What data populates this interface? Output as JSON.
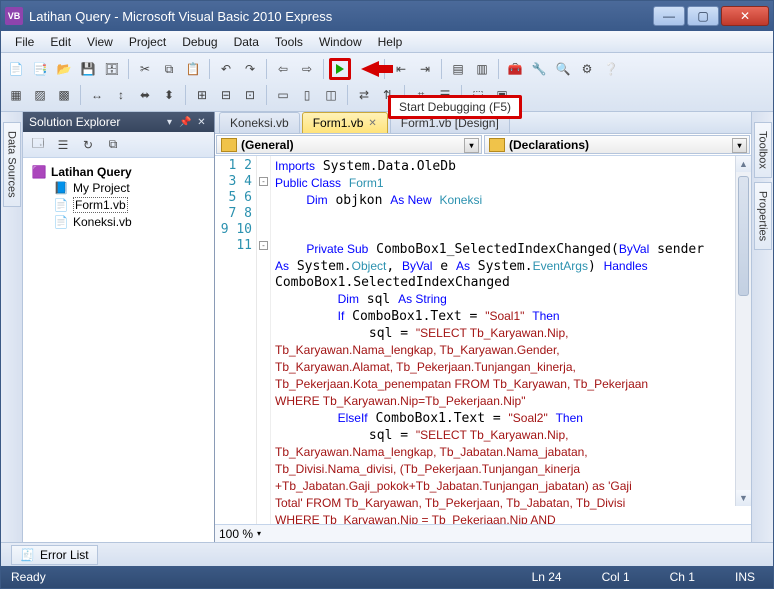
{
  "window": {
    "title": "Latihan Query - Microsoft Visual Basic 2010 Express",
    "icon_text": "VB"
  },
  "menu": [
    "File",
    "Edit",
    "View",
    "Project",
    "Debug",
    "Data",
    "Tools",
    "Window",
    "Help"
  ],
  "tooltip": "Start Debugging (F5)",
  "left_tabs": [
    "Data Sources"
  ],
  "right_tabs": [
    "Toolbox",
    "Properties"
  ],
  "solution": {
    "title": "Solution Explorer",
    "project": "Latihan Query",
    "items": [
      "My Project",
      "Form1.vb",
      "Koneksi.vb"
    ],
    "selected": "Form1.vb"
  },
  "tabs": [
    {
      "label": "Koneksi.vb",
      "active": false
    },
    {
      "label": "Form1.vb",
      "active": true,
      "close": true
    },
    {
      "label": "Form1.vb [Design]",
      "active": false
    }
  ],
  "combos": {
    "left": "(General)",
    "right": "(Declarations)"
  },
  "zoom": "100 %",
  "status": {
    "ready": "Ready",
    "ln": "Ln 24",
    "col": "Col 1",
    "ch": "Ch 1",
    "ins": "INS"
  },
  "error_list": "Error List",
  "gutter": [
    "1",
    "2",
    "3",
    "4",
    "5",
    "6",
    "",
    "",
    "7",
    "8",
    "9",
    "",
    "",
    "",
    "",
    "10",
    "11",
    "",
    "",
    "",
    "",
    "",
    ""
  ],
  "code_lines": [
    [
      {
        "k": "Imports"
      },
      {
        "p": " System.Data.OleDb"
      }
    ],
    [
      {
        "k": "Public Class"
      },
      {
        "p": " "
      },
      {
        "t": "Form1"
      }
    ],
    [
      {
        "p": "    "
      },
      {
        "k": "Dim"
      },
      {
        "p": " objkon "
      },
      {
        "k": "As New"
      },
      {
        "p": " "
      },
      {
        "t": "Koneksi"
      }
    ],
    [
      {
        "p": " "
      }
    ],
    [
      {
        "p": " "
      }
    ],
    [
      {
        "p": "    "
      },
      {
        "k": "Private Sub"
      },
      {
        "p": " ComboBox1_SelectedIndexChanged("
      },
      {
        "k": "ByVal"
      },
      {
        "p": " sender"
      }
    ],
    [
      {
        "k": "As"
      },
      {
        "p": " System."
      },
      {
        "t": "Object"
      },
      {
        "p": ", "
      },
      {
        "k": "ByVal"
      },
      {
        "p": " e "
      },
      {
        "k": "As"
      },
      {
        "p": " System."
      },
      {
        "t": "EventArgs"
      },
      {
        "p": ") "
      },
      {
        "k": "Handles"
      }
    ],
    [
      {
        "p": "ComboBox1.SelectedIndexChanged"
      }
    ],
    [
      {
        "p": "        "
      },
      {
        "k": "Dim"
      },
      {
        "p": " sql "
      },
      {
        "k": "As String"
      }
    ],
    [
      {
        "p": "        "
      },
      {
        "k": "If"
      },
      {
        "p": " ComboBox1.Text = "
      },
      {
        "s": "\"Soal1\""
      },
      {
        "p": " "
      },
      {
        "k": "Then"
      }
    ],
    [
      {
        "p": "            sql = "
      },
      {
        "s": "\"SELECT Tb_Karyawan.Nip,"
      }
    ],
    [
      {
        "s": "Tb_Karyawan.Nama_lengkap, Tb_Karyawan.Gender,"
      }
    ],
    [
      {
        "s": "Tb_Karyawan.Alamat, Tb_Pekerjaan.Tunjangan_kinerja,"
      }
    ],
    [
      {
        "s": "Tb_Pekerjaan.Kota_penempatan FROM Tb_Karyawan, Tb_Pekerjaan"
      }
    ],
    [
      {
        "s": "WHERE Tb_Karyawan.Nip=Tb_Pekerjaan.Nip\""
      }
    ],
    [
      {
        "p": "        "
      },
      {
        "k": "ElseIf"
      },
      {
        "p": " ComboBox1.Text = "
      },
      {
        "s": "\"Soal2\""
      },
      {
        "p": " "
      },
      {
        "k": "Then"
      }
    ],
    [
      {
        "p": "            sql = "
      },
      {
        "s": "\"SELECT Tb_Karyawan.Nip,"
      }
    ],
    [
      {
        "s": "Tb_Karyawan.Nama_lengkap, Tb_Jabatan.Nama_jabatan,"
      }
    ],
    [
      {
        "s": "Tb_Divisi.Nama_divisi, (Tb_Pekerjaan.Tunjangan_kinerja"
      }
    ],
    [
      {
        "s": "+Tb_Jabatan.Gaji_pokok+Tb_Jabatan.Tunjangan_jabatan) as 'Gaji"
      }
    ],
    [
      {
        "s": "Total' FROM Tb_Karyawan, Tb_Pekerjaan, Tb_Jabatan, Tb_Divisi"
      }
    ],
    [
      {
        "s": "WHERE Tb_Karyawan.Nip = Tb_Pekerjaan.Nip AND"
      }
    ]
  ],
  "chart_data": null
}
